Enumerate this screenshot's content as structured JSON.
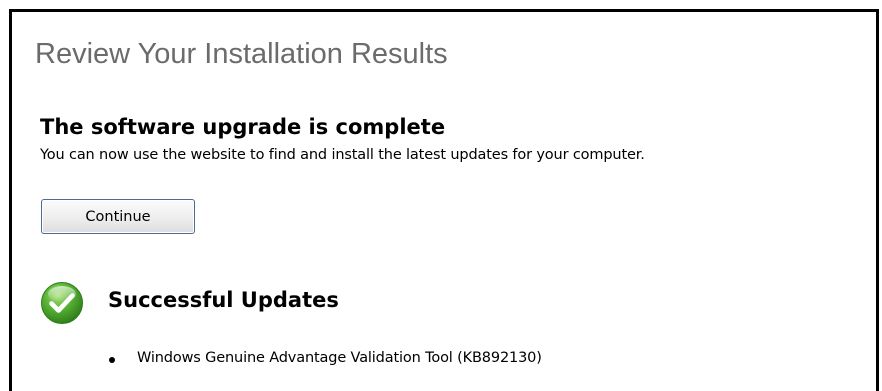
{
  "page": {
    "title": "Review Your Installation Results"
  },
  "status": {
    "heading": "The software upgrade is complete",
    "message": "You can now use the website to find and install the latest updates for your computer."
  },
  "actions": {
    "continue_label": "Continue"
  },
  "results": {
    "icon": "success-check-icon",
    "heading": "Successful Updates",
    "items": [
      "Windows Genuine Advantage Validation Tool (KB892130)"
    ]
  },
  "colors": {
    "title_gray": "#6b6b6b",
    "button_border": "#4d6c92",
    "success_green": "#4ea72e"
  }
}
